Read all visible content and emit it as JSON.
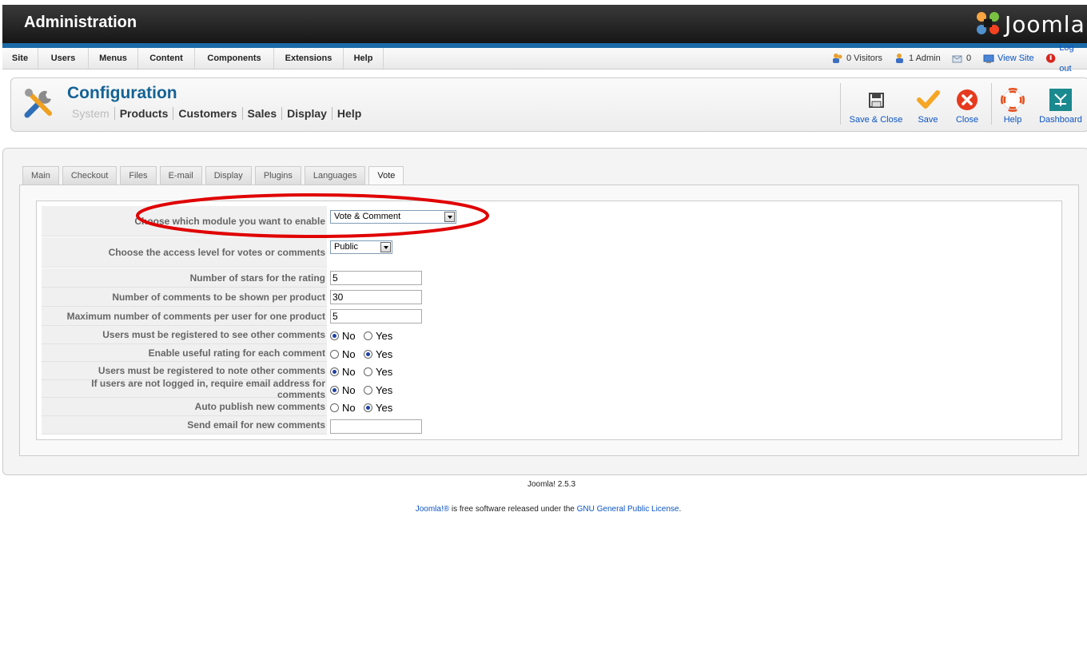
{
  "header": {
    "title": "Administration",
    "logo_text": "Joomla!"
  },
  "menubar": {
    "items": [
      "Site",
      "Users",
      "Menus",
      "Content",
      "Components",
      "Extensions",
      "Help"
    ],
    "status": {
      "visitors": "0 Visitors",
      "admins": "1 Admin",
      "messages": "0",
      "view_site": "View Site",
      "logout": "Log out"
    }
  },
  "toolbar": {
    "title": "Configuration",
    "submenu": [
      "System",
      "Products",
      "Customers",
      "Sales",
      "Display",
      "Help"
    ],
    "buttons": {
      "save_close": "Save & Close",
      "save": "Save",
      "close": "Close",
      "help": "Help",
      "dashboard": "Dashboard"
    }
  },
  "tabs": [
    "Main",
    "Checkout",
    "Files",
    "E-mail",
    "Display",
    "Plugins",
    "Languages",
    "Vote"
  ],
  "active_tab": "Vote",
  "form": {
    "module_label": "Choose which module you want to enable",
    "module_value": "Vote & Comment",
    "access_label": "Choose the access level for votes or comments",
    "access_value": "Public",
    "stars_label": "Number of stars for the rating",
    "stars_value": "5",
    "comments_shown_label": "Number of comments to be shown per product",
    "comments_shown_value": "30",
    "max_comments_label": "Maximum number of comments per user for one product",
    "max_comments_value": "5",
    "reg_see_label": "Users must be registered to see other comments",
    "useful_label": "Enable useful rating for each comment",
    "reg_note_label": "Users must be registered to note other comments",
    "email_req_label": "If users are not logged in, require email address for comments",
    "autopublish_label": "Auto publish new comments",
    "send_email_label": "Send email for new comments",
    "send_email_value": "",
    "no": "No",
    "yes": "Yes"
  },
  "footer": {
    "version": "Joomla! 2.5.3",
    "license_link": "Joomla!®",
    "license_mid": " is free software released under the ",
    "license_gpl": "GNU General Public License",
    "license_end": "."
  },
  "colors": {
    "accent_blue": "#146295",
    "link_blue": "#0b55c4",
    "highlight_red": "#e00000",
    "header_bar": "#1a6aa8"
  }
}
